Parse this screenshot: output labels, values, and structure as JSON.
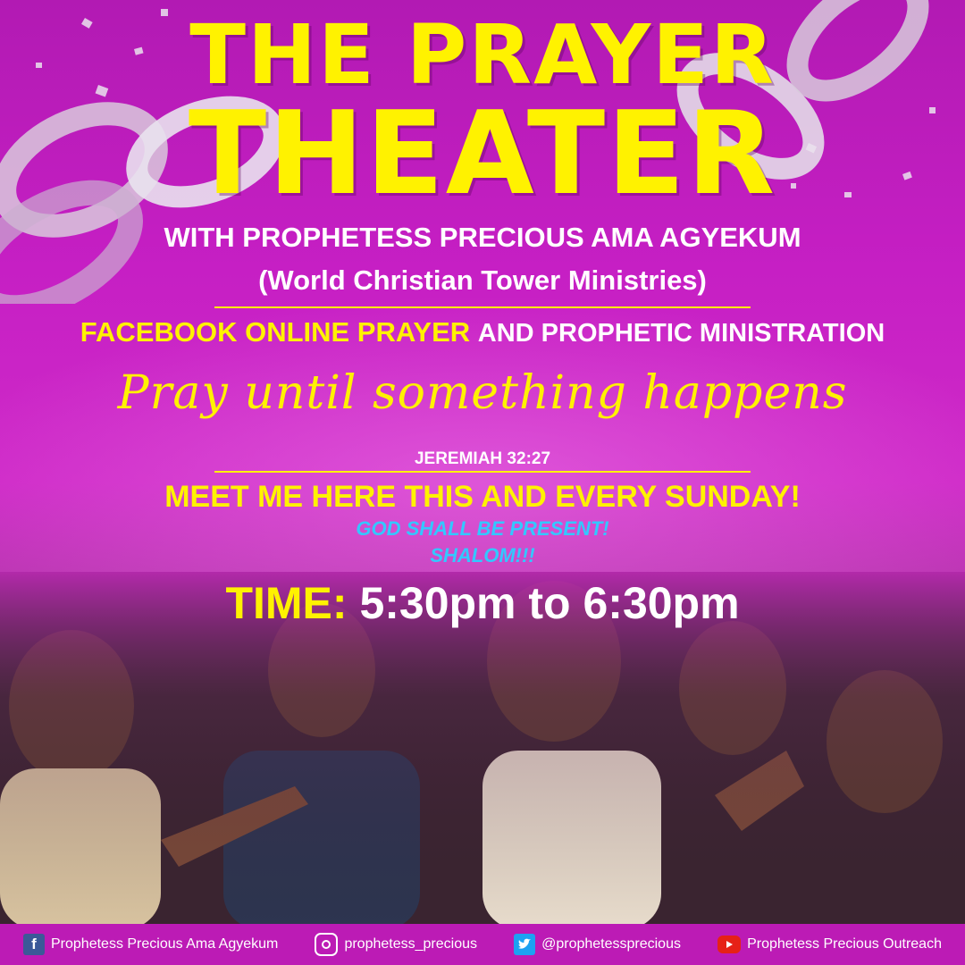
{
  "title": {
    "line1": "THE PRAYER",
    "line2": "THEATER"
  },
  "host": "WITH PROPHETESS PRECIOUS AMA AGYEKUM",
  "ministry": "(World Christian Tower Ministries)",
  "program": {
    "highlight": "FACEBOOK ONLINE PRAYER",
    "rest": "AND PROPHETIC MINISTRATION"
  },
  "tagline": "Pray until something happens",
  "verse": "JEREMIAH 32:27",
  "invite": "MEET ME HERE THIS AND EVERY SUNDAY!",
  "blessing1": "GOD SHALL BE PRESENT!",
  "blessing2": "SHALOM!!!",
  "time": {
    "label": "TIME:",
    "value": "5:30pm to 6:30pm"
  },
  "footer": {
    "facebook": {
      "icon": "facebook-icon",
      "text": "Prophetess Precious Ama Agyekum"
    },
    "instagram": {
      "icon": "instagram-icon",
      "text": "prophetess_precious"
    },
    "twitter": {
      "icon": "twitter-icon",
      "text": "@prophetessprecious"
    },
    "youtube": {
      "icon": "youtube-icon",
      "text": "Prophetess Precious Outreach"
    }
  },
  "colors": {
    "background": "#c61fc4",
    "accent_yellow": "#fff200",
    "accent_blue": "#33c8ff"
  }
}
